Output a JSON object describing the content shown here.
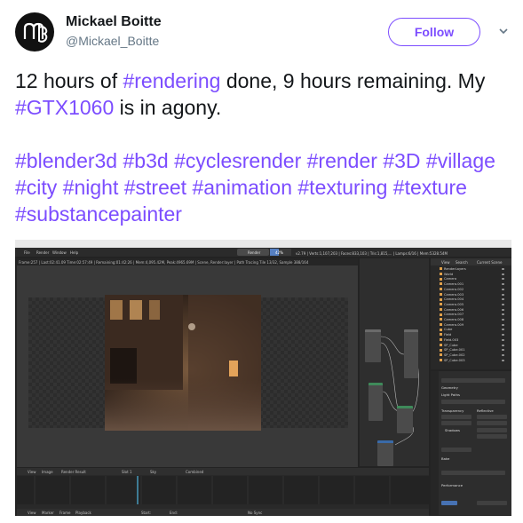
{
  "author": {
    "display_name": "Mickael Boitte",
    "handle": "@Mickael_Boitte"
  },
  "follow_button": {
    "label": "Follow"
  },
  "tweet": {
    "line1": [
      {
        "t": "12 hours of ",
        "h": false
      },
      {
        "t": "#rendering",
        "h": true
      },
      {
        "t": " done, 9 hours remaining. My ",
        "h": false
      },
      {
        "t": "#GTX1060",
        "h": true
      },
      {
        "t": " is in agony.",
        "h": false
      }
    ],
    "hashtags": [
      "#blender3d",
      "#b3d",
      "#cyclesrender",
      "#render",
      "#3D",
      "#village",
      "#city",
      "#night",
      "#street",
      "#animation",
      "#texturing",
      "#texture",
      "#substancepainter"
    ]
  },
  "colors": {
    "accent": "#7c4dff",
    "text": "#14171a",
    "muted": "#657786"
  },
  "blender": {
    "menu": [
      "File",
      "Render",
      "Window",
      "Help"
    ],
    "render_tab": "Render",
    "progress_percent": 42,
    "progress_label": "42%",
    "stats": "v2.79 | Verts:1,107,203 | Faces:833,103 | Tris:1,815,... | Lamps:6/16 | Mem:5328.54M",
    "status_line": "Frame:257 | Last:02:41.09 Time:02:57:49 | Remaining:01:42:26 | Mem:4,095.42M, Peak:4965.69M | Scene, Render:layer | Path Tracing Tile 13/32, Sample 388/164",
    "outliner_tabs": [
      "View",
      "Search",
      "Current Scene"
    ],
    "outliner_items": [
      "RenderLayers",
      "World",
      "Camera",
      "Camera.001",
      "Camera.002",
      "Camera.003",
      "Camera.004",
      "Camera.005",
      "Camera.006",
      "Camera.007",
      "Camera.008",
      "Camera.009",
      "Cube",
      "Field",
      "Field.003",
      "SP_Cube",
      "SP_Cube.001",
      "SP_Cube.002",
      "SP_Cube.003"
    ],
    "props_sections": [
      "Geometry",
      "Light Paths",
      "Transparency",
      "Reflective",
      "Shadows",
      "Bake",
      "Performance"
    ],
    "timeline_labels": [
      "View",
      "Image",
      "Render Result",
      "Slot 1",
      "Sky",
      "Combined"
    ],
    "timeline_footer": [
      "View",
      "Marker",
      "Frame",
      "Playback",
      "Start:",
      "End:",
      "No Sync"
    ]
  }
}
